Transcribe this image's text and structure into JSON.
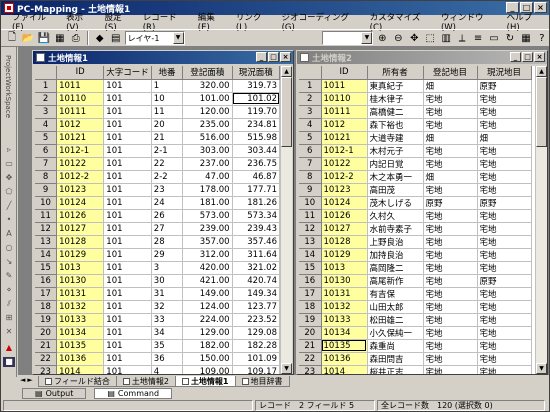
{
  "app": {
    "title": "PC-Mapping - 土地情報1"
  },
  "menu": [
    "ファイル(F)",
    "表示(V)",
    "設定(S)",
    "レコード(R)",
    "編集(E)",
    "リンク(L)",
    "ジオコーディング(G)",
    "カスタマイズ(C)",
    "ウィンドウ(W)",
    "ヘルプ(H)"
  ],
  "toolbar": {
    "layer": "レイヤ-1"
  },
  "sidebar": {
    "label": "ProjectWorkSpace"
  },
  "win1": {
    "title": "土地情報1",
    "headers": [
      "",
      "ID",
      "大字コード",
      "地番",
      "登記面積",
      "現況面積"
    ],
    "rows": [
      [
        "1",
        "1011",
        "101",
        "1",
        "320.00",
        "319.73"
      ],
      [
        "2",
        "10110",
        "101",
        "10",
        "101.00",
        "101.02"
      ],
      [
        "3",
        "10111",
        "101",
        "11",
        "120.00",
        "119.70"
      ],
      [
        "4",
        "1012",
        "101",
        "20",
        "235.00",
        "234.81"
      ],
      [
        "5",
        "10121",
        "101",
        "21",
        "516.00",
        "515.98"
      ],
      [
        "6",
        "1012-1",
        "101",
        "2-1",
        "303.00",
        "303.44"
      ],
      [
        "7",
        "10122",
        "101",
        "22",
        "237.00",
        "236.75"
      ],
      [
        "8",
        "1012-2",
        "101",
        "2-2",
        "47.00",
        "46.87"
      ],
      [
        "9",
        "10123",
        "101",
        "23",
        "178.00",
        "177.71"
      ],
      [
        "10",
        "10124",
        "101",
        "24",
        "181.00",
        "181.26"
      ],
      [
        "11",
        "10126",
        "101",
        "26",
        "573.00",
        "573.34"
      ],
      [
        "12",
        "10127",
        "101",
        "27",
        "239.00",
        "239.43"
      ],
      [
        "13",
        "10128",
        "101",
        "28",
        "357.00",
        "357.46"
      ],
      [
        "14",
        "10129",
        "101",
        "29",
        "312.00",
        "311.64"
      ],
      [
        "15",
        "1013",
        "101",
        "3",
        "420.00",
        "321.02"
      ],
      [
        "16",
        "10130",
        "101",
        "30",
        "421.00",
        "420.74"
      ],
      [
        "17",
        "10131",
        "101",
        "31",
        "149.00",
        "149.34"
      ],
      [
        "18",
        "10132",
        "101",
        "32",
        "124.00",
        "123.77"
      ],
      [
        "19",
        "10133",
        "101",
        "33",
        "224.00",
        "223.52"
      ],
      [
        "20",
        "10134",
        "101",
        "34",
        "129.00",
        "129.08"
      ],
      [
        "21",
        "10135",
        "101",
        "35",
        "182.00",
        "182.28"
      ],
      [
        "22",
        "10136",
        "101",
        "36",
        "150.00",
        "101.09"
      ],
      [
        "23",
        "1014",
        "101",
        "4",
        "109.00",
        "109.17"
      ]
    ]
  },
  "win2": {
    "title": "土地情報2",
    "headers": [
      "",
      "ID",
      "所有者",
      "登記地目",
      "現況地目"
    ],
    "rows": [
      [
        "1",
        "1011",
        "東真紀子",
        "畑",
        "原野"
      ],
      [
        "2",
        "10110",
        "桂木律子",
        "宅地",
        "宅地"
      ],
      [
        "3",
        "10111",
        "高橋健二",
        "宅地",
        "宅地"
      ],
      [
        "4",
        "1012",
        "森下裕也",
        "宅地",
        "宅地"
      ],
      [
        "5",
        "10121",
        "大道寺建",
        "畑",
        "畑"
      ],
      [
        "6",
        "1012-1",
        "木村元子",
        "宅地",
        "宅地"
      ],
      [
        "7",
        "10122",
        "内記日覚",
        "宅地",
        "宅地"
      ],
      [
        "8",
        "1012-2",
        "木之本勇一",
        "畑",
        "宅地"
      ],
      [
        "9",
        "10123",
        "高田茂",
        "宅地",
        "宅地"
      ],
      [
        "10",
        "10124",
        "茂木しげる",
        "原野",
        "原野"
      ],
      [
        "11",
        "10126",
        "久村久",
        "宅地",
        "宅地"
      ],
      [
        "12",
        "10127",
        "水前寺素子",
        "宅地",
        "宅地"
      ],
      [
        "13",
        "10128",
        "上野良治",
        "宅地",
        "宅地"
      ],
      [
        "14",
        "10129",
        "加持良治",
        "宅地",
        "宅地"
      ],
      [
        "15",
        "1013",
        "高岡隆二",
        "宅地",
        "宅地"
      ],
      [
        "16",
        "10130",
        "高尾新作",
        "宅地",
        "原野"
      ],
      [
        "17",
        "10131",
        "有吉保",
        "宅地",
        "宅地"
      ],
      [
        "18",
        "10132",
        "山田太郎",
        "宅地",
        "宅地"
      ],
      [
        "19",
        "10133",
        "松田雄二",
        "宅地",
        "宅地"
      ],
      [
        "20",
        "10134",
        "小久保純一",
        "宅地",
        "宅地"
      ],
      [
        "21",
        "10135",
        "森重尚",
        "宅地",
        "宅地"
      ],
      [
        "22",
        "10136",
        "森田問吉",
        "宅地",
        "宅地"
      ],
      [
        "23",
        "1014",
        "桜井正志",
        "宅地",
        "宅地"
      ]
    ]
  },
  "tabs": [
    "フィールド結合",
    "土地情報2",
    "土地情報1",
    "地目辞書"
  ],
  "output_tabs": [
    "Output",
    "Command"
  ],
  "status": {
    "left": "",
    "record": "レコード　2 フィールド 5",
    "total": "全レコード数　120 (選択数 0)"
  }
}
